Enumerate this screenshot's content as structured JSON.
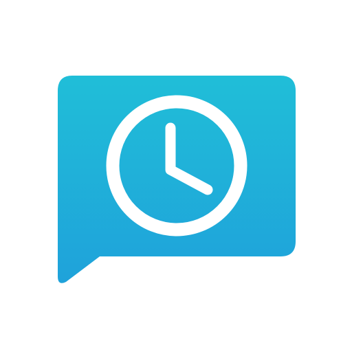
{
  "icon": {
    "name": "scheduled-message-app-icon",
    "depicts": "chat-bubble-with-clock",
    "colors": {
      "background": "#ffffff",
      "bubble_gradient_top": "#20BED8",
      "bubble_gradient_bottom": "#1FA2DA",
      "clock_stroke": "#ffffff"
    }
  }
}
